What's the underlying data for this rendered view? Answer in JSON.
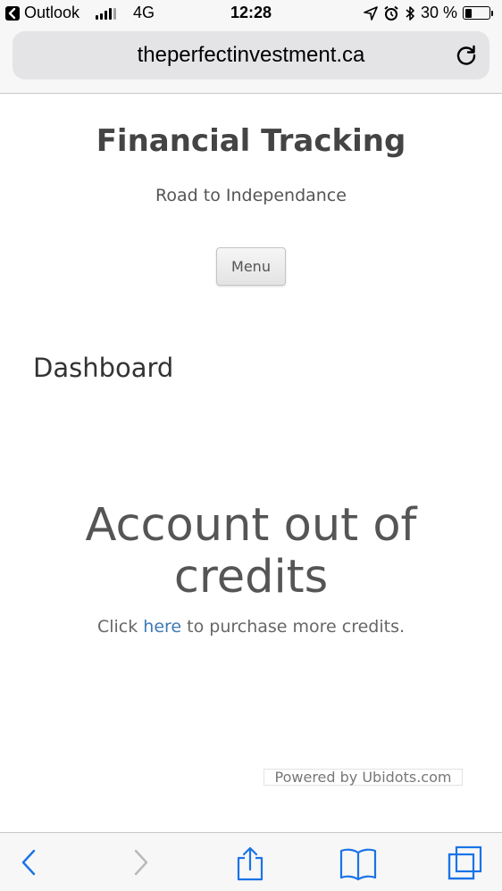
{
  "status_bar": {
    "back_app": "Outlook",
    "network": "4G",
    "time": "12:28",
    "battery_percent": "30 %",
    "battery_level": 0.3
  },
  "browser": {
    "url": "theperfectinvestment.ca"
  },
  "site": {
    "title": "Financial Tracking",
    "tagline": "Road to Independance",
    "menu_label": "Menu"
  },
  "main": {
    "dashboard_heading": "Dashboard",
    "credits_heading_line1": "Account out of",
    "credits_heading_line2": "credits",
    "credits_text_before": "Click ",
    "credits_link": "here",
    "credits_text_after": " to purchase more credits.",
    "powered_by": "Powered by Ubidots.com"
  },
  "colors": {
    "accent": "#3c7ab5",
    "toolbar_enabled": "#1a73e8",
    "toolbar_disabled": "#b8b8b8"
  }
}
